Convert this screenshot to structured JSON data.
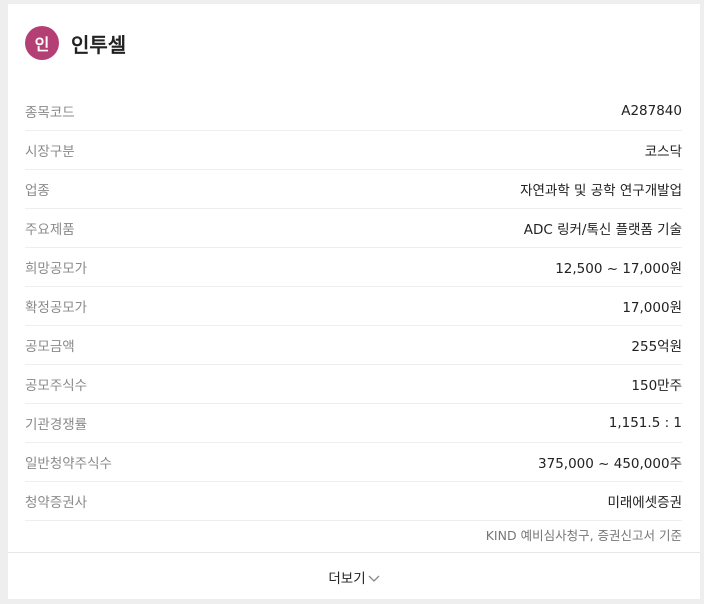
{
  "company": {
    "avatar_text": "인",
    "name": "인투셀"
  },
  "details": [
    {
      "label": "종목코드",
      "value": "A287840"
    },
    {
      "label": "시장구분",
      "value": "코스닥"
    },
    {
      "label": "업종",
      "value": "자연과학 및 공학 연구개발업"
    },
    {
      "label": "주요제품",
      "value": "ADC 링커/톡신 플랫폼 기술"
    },
    {
      "label": "희망공모가",
      "value": "12,500 ~ 17,000원"
    },
    {
      "label": "확정공모가",
      "value": "17,000원"
    },
    {
      "label": "공모금액",
      "value": "255억원"
    },
    {
      "label": "공모주식수",
      "value": "150만주"
    },
    {
      "label": "기관경쟁률",
      "value": "1,151.5 : 1"
    },
    {
      "label": "일반청약주식수",
      "value": "375,000 ~ 450,000주"
    },
    {
      "label": "청약증권사",
      "value": "미래에셋증권"
    }
  ],
  "source_note": "KIND 예비심사청구, 증권신고서 기준",
  "footer": {
    "more_label": "더보기"
  },
  "colors": {
    "avatar_bg": "#b43f74"
  }
}
